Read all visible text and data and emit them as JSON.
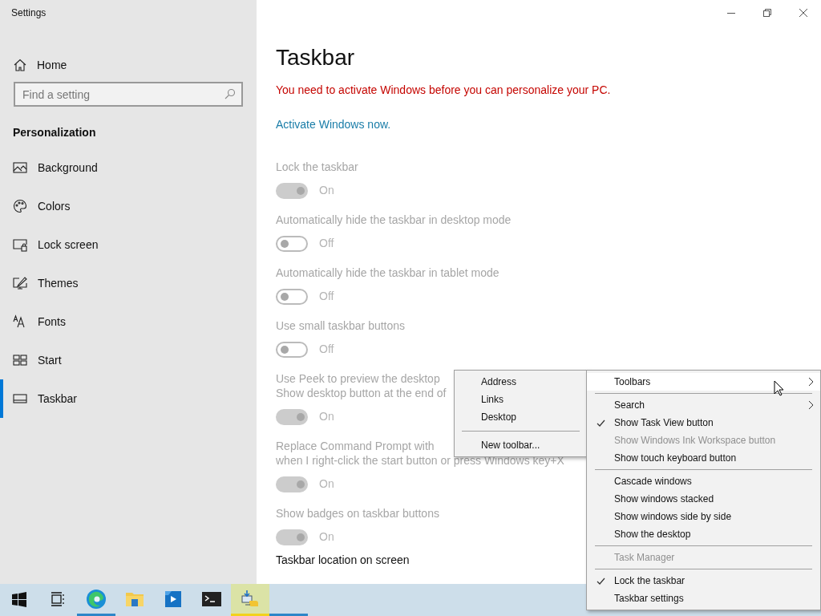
{
  "window": {
    "title": "Settings"
  },
  "sidebar": {
    "home": "Home",
    "search": {
      "placeholder": "Find a setting"
    },
    "section": "Personalization",
    "items": [
      {
        "label": "Background",
        "selected": false
      },
      {
        "label": "Colors",
        "selected": false
      },
      {
        "label": "Lock screen",
        "selected": false
      },
      {
        "label": "Themes",
        "selected": false
      },
      {
        "label": "Fonts",
        "selected": false
      },
      {
        "label": "Start",
        "selected": false
      },
      {
        "label": "Taskbar",
        "selected": true
      }
    ]
  },
  "page": {
    "title": "Taskbar",
    "warning": "You need to activate Windows before you can personalize your PC.",
    "link": "Activate Windows now.",
    "settings": [
      {
        "label": [
          "Lock the taskbar"
        ],
        "on": true,
        "state": "On",
        "disabled": true
      },
      {
        "label": [
          "Automatically hide the taskbar in desktop mode"
        ],
        "on": false,
        "state": "Off",
        "disabled": true
      },
      {
        "label": [
          "Automatically hide the taskbar in tablet mode"
        ],
        "on": false,
        "state": "Off",
        "disabled": true
      },
      {
        "label": [
          "Use small taskbar buttons"
        ],
        "on": false,
        "state": "Off",
        "disabled": true
      },
      {
        "label": [
          "Use Peek to preview the desktop",
          "Show desktop button at the end of"
        ],
        "on": true,
        "state": "On",
        "disabled": true
      },
      {
        "label": [
          "Replace Command Prompt with",
          "when I right-click the start button or press Windows key+X"
        ],
        "on": true,
        "state": "On",
        "disabled": true
      },
      {
        "label": [
          "Show badges on taskbar buttons"
        ],
        "on": true,
        "state": "On",
        "disabled": true
      }
    ],
    "footer": "Taskbar location on screen"
  },
  "submenu": [
    {
      "kind": "item",
      "label": "Address"
    },
    {
      "kind": "item",
      "label": "Links"
    },
    {
      "kind": "item",
      "label": "Desktop"
    },
    {
      "kind": "separator"
    },
    {
      "kind": "item",
      "label": "New toolbar..."
    }
  ],
  "context_menu": [
    {
      "kind": "item",
      "label": "Toolbars",
      "submenu": true,
      "checked": false,
      "disabled": false,
      "selected": true
    },
    {
      "kind": "separator"
    },
    {
      "kind": "item",
      "label": "Search",
      "submenu": true,
      "checked": false,
      "disabled": false,
      "selected": false
    },
    {
      "kind": "item",
      "label": "Show Task View button",
      "submenu": false,
      "checked": true,
      "disabled": false,
      "selected": false
    },
    {
      "kind": "item",
      "label": "Show Windows Ink Workspace button",
      "submenu": false,
      "checked": false,
      "disabled": true,
      "selected": false
    },
    {
      "kind": "item",
      "label": "Show touch keyboard button",
      "submenu": false,
      "checked": false,
      "disabled": false,
      "selected": false
    },
    {
      "kind": "separator"
    },
    {
      "kind": "item",
      "label": "Cascade windows",
      "submenu": false,
      "checked": false,
      "disabled": false,
      "selected": false
    },
    {
      "kind": "item",
      "label": "Show windows stacked",
      "submenu": false,
      "checked": false,
      "disabled": false,
      "selected": false
    },
    {
      "kind": "item",
      "label": "Show windows side by side",
      "submenu": false,
      "checked": false,
      "disabled": false,
      "selected": false
    },
    {
      "kind": "item",
      "label": "Show the desktop",
      "submenu": false,
      "checked": false,
      "disabled": false,
      "selected": false
    },
    {
      "kind": "separator"
    },
    {
      "kind": "item",
      "label": "Task Manager",
      "submenu": false,
      "checked": false,
      "disabled": true,
      "selected": false
    },
    {
      "kind": "separator"
    },
    {
      "kind": "item",
      "label": "Lock the taskbar",
      "submenu": false,
      "checked": true,
      "disabled": false,
      "selected": false
    },
    {
      "kind": "item",
      "label": "Taskbar settings",
      "submenu": false,
      "checked": false,
      "disabled": false,
      "selected": false
    }
  ],
  "taskbar": [
    {
      "kind": "start",
      "running": false,
      "selected": false
    },
    {
      "kind": "taskview",
      "running": false,
      "selected": false
    },
    {
      "kind": "edge",
      "running": true,
      "selected": false
    },
    {
      "kind": "explorer",
      "running": false,
      "selected": false
    },
    {
      "kind": "media",
      "running": false,
      "selected": false
    },
    {
      "kind": "terminal",
      "running": false,
      "selected": false
    },
    {
      "kind": "python",
      "running": true,
      "selected": true
    },
    {
      "kind": "settings",
      "running": true,
      "selected": false
    }
  ]
}
